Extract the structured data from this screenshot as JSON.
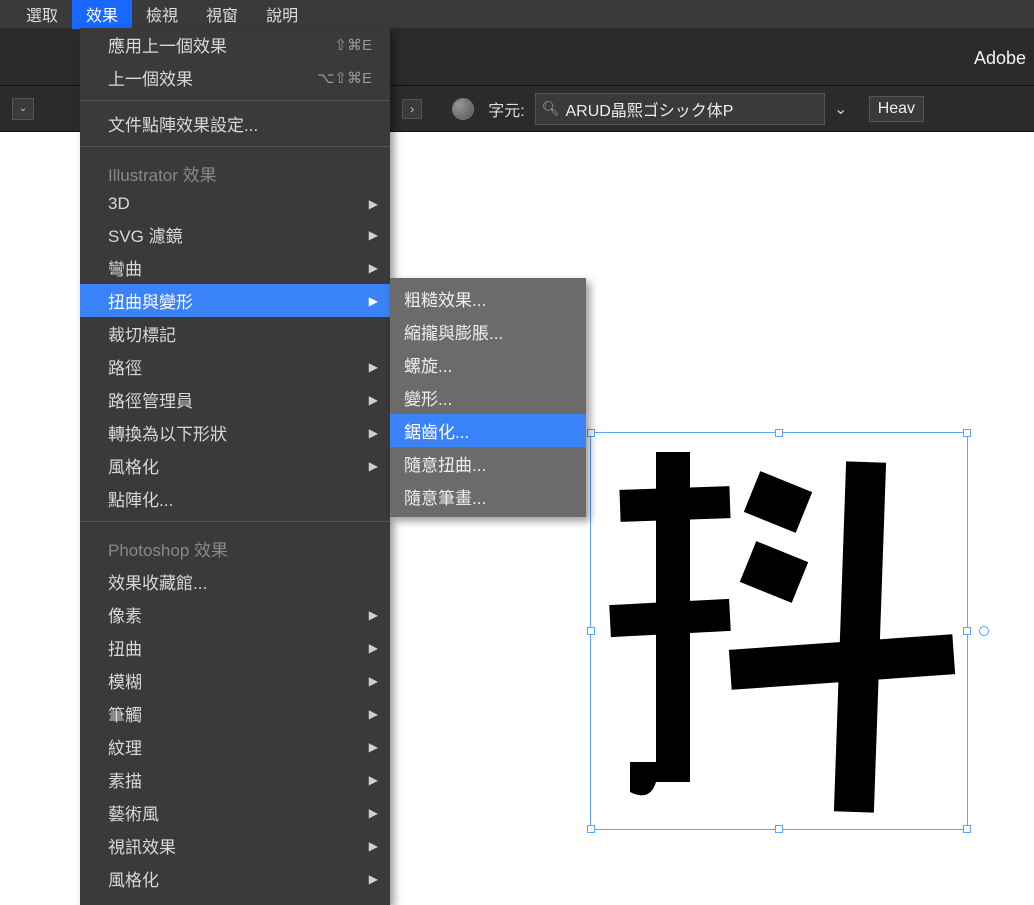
{
  "menubar": {
    "items": [
      "選取",
      "效果",
      "檢視",
      "視窗",
      "說明"
    ],
    "active_index": 1
  },
  "brand": "Adobe",
  "controlbar": {
    "percent_suffix": "%",
    "char_label": "字元:",
    "font_name": "ARUD晶熙ゴシック体P",
    "weight": "Heav"
  },
  "dropdown": {
    "apply_last": {
      "label": "應用上一個效果",
      "shortcut": "⇧⌘E"
    },
    "last_effect": {
      "label": "上一個效果",
      "shortcut": "⌥⇧⌘E"
    },
    "raster_settings": "文件點陣效果設定...",
    "illustrator_header": "Illustrator 效果",
    "il_items": [
      {
        "label": "3D",
        "arrow": true
      },
      {
        "label": "SVG 濾鏡",
        "arrow": true
      },
      {
        "label": "彎曲",
        "arrow": true
      },
      {
        "label": "扭曲與變形",
        "arrow": true,
        "highlight": true
      },
      {
        "label": "裁切標記",
        "arrow": false
      },
      {
        "label": "路徑",
        "arrow": true
      },
      {
        "label": "路徑管理員",
        "arrow": true
      },
      {
        "label": "轉換為以下形狀",
        "arrow": true
      },
      {
        "label": "風格化",
        "arrow": true
      },
      {
        "label": "點陣化...",
        "arrow": false
      }
    ],
    "photoshop_header": "Photoshop 效果",
    "ps_items": [
      {
        "label": "效果收藏館...",
        "arrow": false
      },
      {
        "label": "像素",
        "arrow": true
      },
      {
        "label": "扭曲",
        "arrow": true
      },
      {
        "label": "模糊",
        "arrow": true
      },
      {
        "label": "筆觸",
        "arrow": true
      },
      {
        "label": "紋理",
        "arrow": true
      },
      {
        "label": "素描",
        "arrow": true
      },
      {
        "label": "藝術風",
        "arrow": true
      },
      {
        "label": "視訊效果",
        "arrow": true
      },
      {
        "label": "風格化",
        "arrow": true
      }
    ]
  },
  "submenu": {
    "items": [
      {
        "label": "粗糙效果..."
      },
      {
        "label": "縮攏與膨脹..."
      },
      {
        "label": "螺旋..."
      },
      {
        "label": "變形..."
      },
      {
        "label": "鋸齒化...",
        "highlight": true
      },
      {
        "label": "隨意扭曲..."
      },
      {
        "label": "隨意筆畫..."
      }
    ]
  },
  "artboard": {
    "selected_glyph": "抖"
  }
}
